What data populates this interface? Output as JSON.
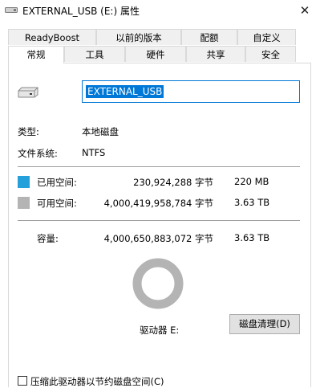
{
  "window": {
    "title": "EXTERNAL_USB (E:) 属性",
    "close_glyph": "✕"
  },
  "tabs_row1": [
    "ReadyBoost",
    "以前的版本",
    "配额",
    "自定义"
  ],
  "tabs_row2": [
    "常规",
    "工具",
    "硬件",
    "共享",
    "安全"
  ],
  "active_tab": "常规",
  "drive": {
    "name": "EXTERNAL_USB"
  },
  "info": {
    "type_label": "类型:",
    "type_value": "本地磁盘",
    "fs_label": "文件系统:",
    "fs_value": "NTFS"
  },
  "space": {
    "used_label": "已用空间:",
    "used_bytes": "230,924,288 字节",
    "used_size": "220 MB",
    "free_label": "可用空间:",
    "free_bytes": "4,000,419,958,784 字节",
    "free_size": "3.63 TB",
    "capacity_label": "容量:",
    "capacity_bytes": "4,000,650,883,072 字节",
    "capacity_size": "3.63 TB"
  },
  "drive_label": "驱动器 E:",
  "cleanup_button": "磁盘清理(D)",
  "compress_label": "压缩此驱动器以节约磁盘空间(C)",
  "colors": {
    "used": "#26a0da",
    "free": "#b4b4b4",
    "accent": "#0078d7"
  },
  "usage_fraction_used": 5.77e-05
}
